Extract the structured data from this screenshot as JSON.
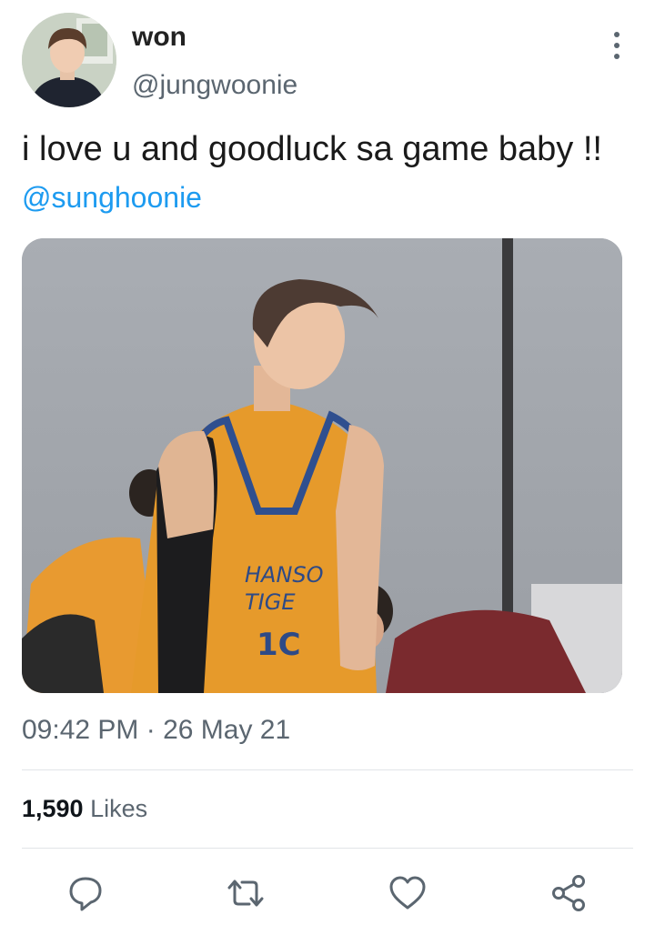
{
  "author": {
    "display_name": "won",
    "handle": "@jungwoonie"
  },
  "tweet": {
    "text": "i love u and goodluck sa game baby !! ",
    "mention": "@sunghoonie",
    "time": "09:42 PM",
    "separator": " · ",
    "date": "26 May 21"
  },
  "stats": {
    "likes_count": "1,590",
    "likes_label": "Likes"
  },
  "media": {
    "jersey_text_line1": "HANSO",
    "jersey_text_line2": "TIGE",
    "jersey_number": "1C"
  },
  "icons": {
    "more": "more-vertical-icon",
    "reply": "reply-icon",
    "retweet": "retweet-icon",
    "like": "heart-icon",
    "share": "share-icon"
  },
  "colors": {
    "accent": "#1d9bf0",
    "secondary_text": "#5b6670",
    "icon": "#5b6670"
  }
}
